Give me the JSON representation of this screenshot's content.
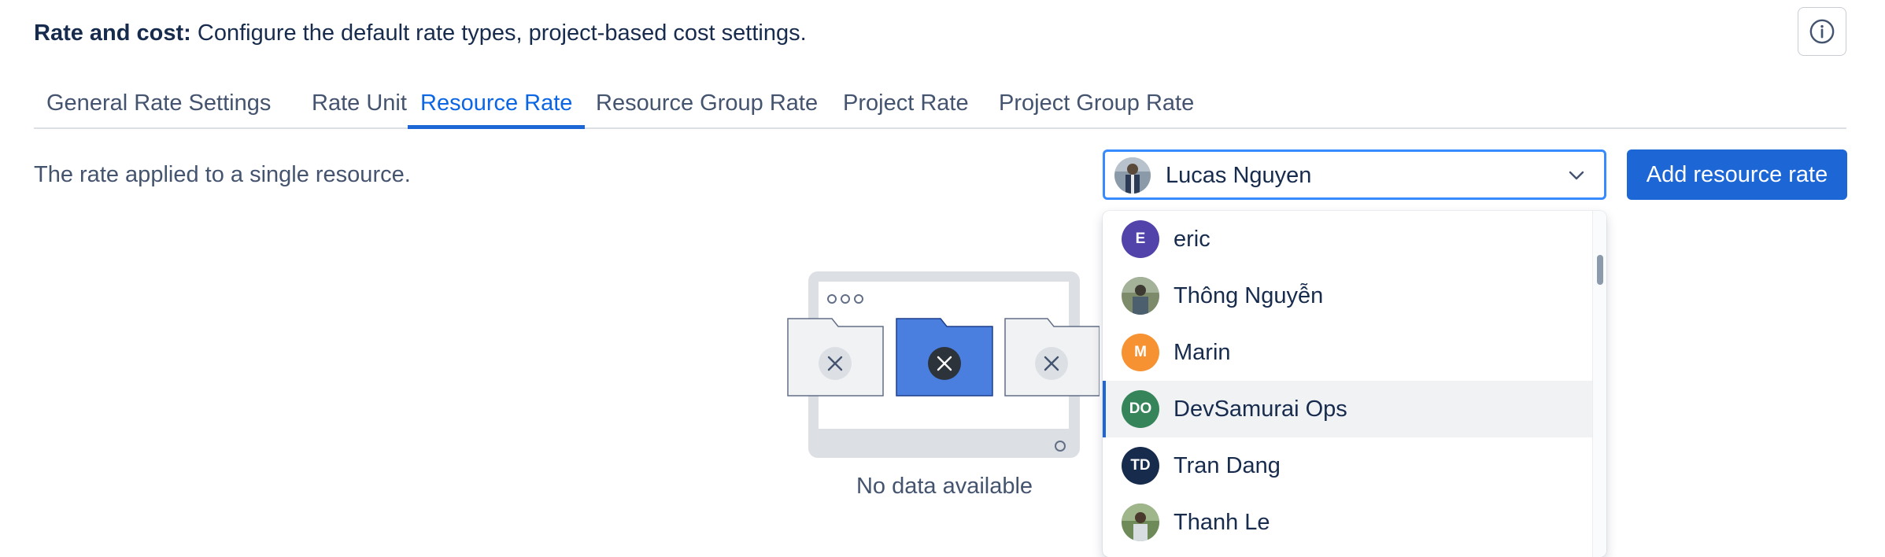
{
  "header": {
    "title_bold": "Rate and cost:",
    "title_text": " Configure the default rate types, project-based cost settings."
  },
  "tabs": [
    {
      "label": "General Rate Settings",
      "active": false
    },
    {
      "label": "Rate Unit",
      "active": false
    },
    {
      "label": "Resource Rate",
      "active": true
    },
    {
      "label": "Resource Group Rate",
      "active": false
    },
    {
      "label": "Project Rate",
      "active": false
    },
    {
      "label": "Project Group Rate",
      "active": false
    }
  ],
  "content": {
    "description": "The rate applied to a single resource.",
    "selected_resource": "Lucas Nguyen",
    "add_button_label": "Add resource rate",
    "empty_text": "No data available"
  },
  "dropdown": {
    "options": [
      {
        "name": "eric",
        "initials": "E",
        "color": "#5243aa",
        "photo": false
      },
      {
        "name": "Thông Nguyễn",
        "initials": "",
        "color": "#6b7a5a",
        "photo": true
      },
      {
        "name": "Marin",
        "initials": "M",
        "color": "#f79232",
        "photo": false
      },
      {
        "name": "DevSamurai Ops",
        "initials": "DO",
        "color": "#36845a",
        "photo": false,
        "highlighted": true
      },
      {
        "name": "Tran Dang",
        "initials": "TD",
        "color": "#172b4d",
        "photo": false
      },
      {
        "name": "Thanh Le",
        "initials": "",
        "color": "#5d7a4a",
        "photo": true
      }
    ]
  },
  "colors": {
    "accent": "#1d66d6",
    "focus_border": "#388bff",
    "text": "#172b4d",
    "subtle_text": "#44546f"
  }
}
